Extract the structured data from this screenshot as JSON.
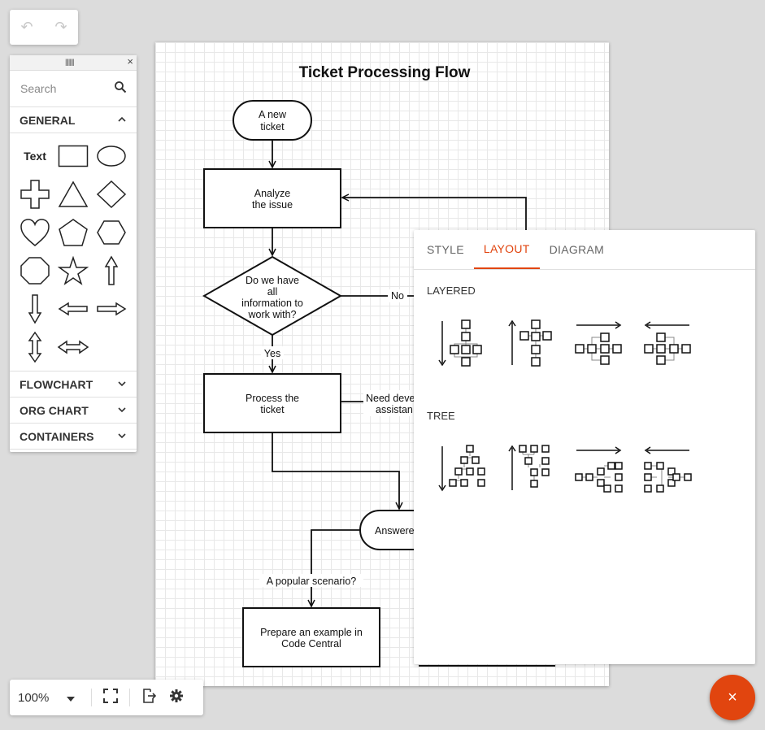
{
  "history": {
    "undo_icon": "undo-icon",
    "redo_icon": "redo-icon",
    "undo_glyph": "↶",
    "redo_glyph": "↷"
  },
  "toolbox": {
    "search_placeholder": "Search",
    "close_glyph": "×",
    "categories": {
      "general": "GENERAL",
      "flowchart": "FLOWCHART",
      "org_chart": "ORG CHART",
      "containers": "CONTAINERS"
    },
    "text_shape_label": "Text"
  },
  "diagram": {
    "title": "Ticket Processing Flow",
    "nodes": {
      "new_ticket_1": "A new",
      "new_ticket_2": "ticket",
      "analyze_1": "Analyze",
      "analyze_2": "the issue",
      "question_1": "Do we have",
      "question_2": "all",
      "question_3": "information to",
      "question_4": "work with?",
      "process_1": "Process the",
      "process_2": "ticket",
      "answered": "Answere",
      "prepare_1": "Prepare an example in",
      "prepare_2": "Code Central"
    },
    "edges": {
      "no": "No",
      "yes": "Yes",
      "need_dev_1": "Need deve",
      "need_dev_2": "assistan",
      "popular": "A popular scenario?"
    }
  },
  "properties": {
    "tabs": {
      "style": "STYLE",
      "layout": "LAYOUT",
      "diagram": "DIAGRAM"
    },
    "active_tab": "LAYOUT",
    "sections": {
      "layered": "LAYERED",
      "tree": "TREE"
    }
  },
  "zoom": {
    "level": "100%"
  },
  "fab": {
    "glyph": "×"
  },
  "colors": {
    "accent": "#e1450f"
  }
}
